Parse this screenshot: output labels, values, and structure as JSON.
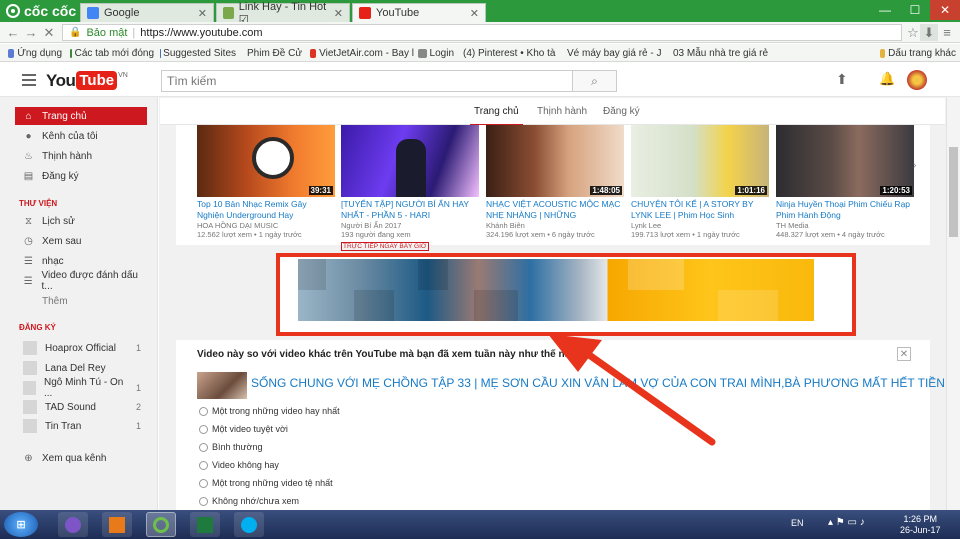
{
  "browser": {
    "brand": "cốc cốc",
    "tabs": [
      {
        "label": "Google",
        "color": "#4285f4"
      },
      {
        "label": "Link Hay - Tin Hot ☑",
        "color": "#7aa84a"
      },
      {
        "label": "YouTube",
        "color": "#e62117"
      }
    ],
    "address": {
      "secure_label": "Bảo mật",
      "url": "https://www.youtube.com"
    },
    "bookmarks": [
      "Ứng dụng",
      "Các tab mới đóng",
      "Suggested Sites",
      "Phim Đề Cử",
      "VietJetAir.com - Bay l",
      "Login",
      "(4) Pinterest • Kho tàn",
      "Vé máy bay giá rẻ - Je",
      "03 Mẫu nhà tre giá rẻ",
      "Dấu trang khác"
    ]
  },
  "header": {
    "logo_you": "You",
    "logo_tube": "Tube",
    "logo_region": "VN",
    "search_placeholder": "Tìm kiếm"
  },
  "sidebar": {
    "main_items": [
      {
        "label": "Trang chủ",
        "icon": "home-icon"
      },
      {
        "label": "Kênh của tôi",
        "icon": "user-icon"
      },
      {
        "label": "Thịnh hành",
        "icon": "fire-icon"
      },
      {
        "label": "Đăng ký",
        "icon": "subscriptions-icon"
      }
    ],
    "library_heading": "THƯ VIỆN",
    "library_items": [
      {
        "label": "Lịch sử",
        "icon": "history-icon"
      },
      {
        "label": "Xem sau",
        "icon": "clock-icon"
      },
      {
        "label": "nhạc",
        "icon": "playlist-icon"
      },
      {
        "label": "Video được đánh dấu t...",
        "icon": "playlist-icon"
      }
    ],
    "more_label": "Thêm",
    "subs_heading": "ĐĂNG KÝ",
    "subscriptions": [
      {
        "name": "Hoaprox Official",
        "count": "1"
      },
      {
        "name": "Lana Del Rey",
        "count": ""
      },
      {
        "name": "Ngô Minh Tú - On ...",
        "count": "1"
      },
      {
        "name": "TAD Sound",
        "count": "2"
      },
      {
        "name": "Tin Tran",
        "count": "1"
      }
    ],
    "browse_channels": "Xem qua kênh"
  },
  "feed_tabs": [
    "Trang chủ",
    "Thịnh hành",
    "Đăng ký"
  ],
  "videos": [
    {
      "title": "Top 10 Bản Nhạc Remix Gây Nghiện Underground Hay",
      "channel": "HOA HỒNG DẠI MUSIC",
      "meta": "12.562 lượt xem • 1 ngày trước",
      "duration": "39:31",
      "live": ""
    },
    {
      "title": "[TUYỂN TẬP] NGƯỜI BÍ ẨN HAY NHẤT - PHẦN 5 - HARI",
      "channel": "Người Bí Ẩn 2017",
      "meta": "193 người đang xem",
      "duration": "",
      "live": "TRỰC TIẾP NGAY BÂY GIỜ"
    },
    {
      "title": "NHẠC VIỆT ACOUSTIC MỘC MẠC NHẸ NHÀNG | NHỮNG",
      "channel": "Khánh Biên",
      "meta": "324.196 lượt xem • 6 ngày trước",
      "duration": "1:48:05",
      "live": ""
    },
    {
      "title": "CHUYỆN TÔI KỂ | A STORY BY LYNK LEE | Phim Học Sinh",
      "channel": "Lynk Lee",
      "meta": "199.713 lượt xem • 1 ngày trước",
      "duration": "1:01:16",
      "live": ""
    },
    {
      "title": "Ninja Huyền Thoại Phim Chiếu Rạp Phim Hành Động",
      "channel": "TH Media",
      "meta": "448.327 lượt xem • 4 ngày trước",
      "duration": "1:20:53",
      "live": ""
    }
  ],
  "survey": {
    "question": "Video này so với video khác trên YouTube mà bạn đã xem tuần này như thế nào?",
    "video_title": "SỐNG CHUNG VỚI MẸ CHỒNG TẬP 33 | MẸ SƠN CẦU XIN VÂN LÀM VỢ CỦA CON TRAI MÌNH,BÀ PHƯƠNG MẤT HẾT TIỀN",
    "options": [
      "Một trong những video hay nhất",
      "Một video tuyệt vời",
      "Bình thường",
      "Video không hay",
      "Một trong những video tệ nhất",
      "Không nhớ/chưa xem"
    ]
  },
  "taskbar": {
    "lang": "EN",
    "time": "1:26 PM",
    "date": "26-Jun-17"
  }
}
